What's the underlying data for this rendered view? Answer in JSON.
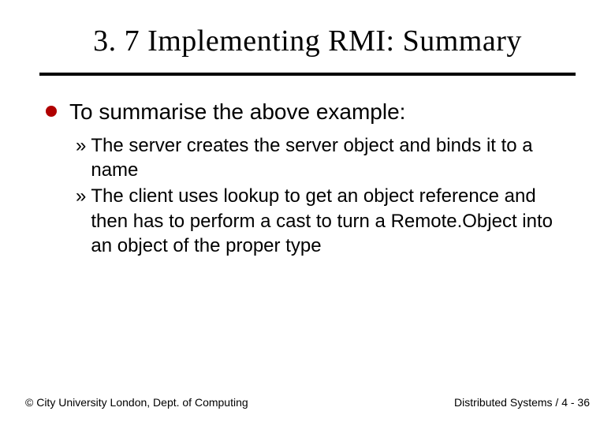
{
  "slide": {
    "title": "3. 7 Implementing RMI: Summary",
    "bullet": {
      "text": "To summarise the above example:"
    },
    "sub_items": [
      {
        "marker": "»",
        "text": "The server creates the server object and binds it to a name"
      },
      {
        "marker": "»",
        "text": "The client uses lookup to get an object reference and then has to perform a cast to turn a Remote.Object into an object of the proper type"
      }
    ],
    "footer": {
      "left": "© City University London, Dept. of Computing",
      "right": "Distributed Systems / 4 - 36"
    }
  }
}
